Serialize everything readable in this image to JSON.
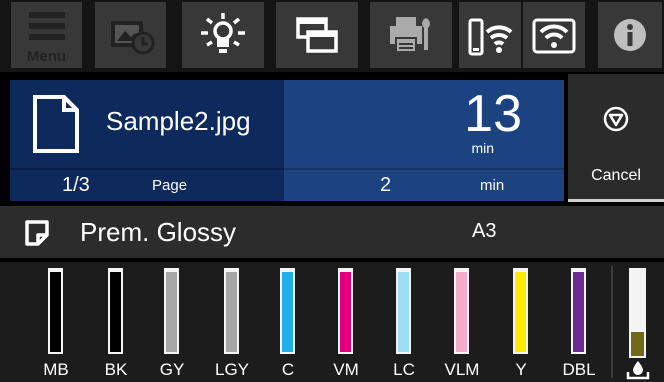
{
  "toolbar": {
    "menu_label": "Menu",
    "buttons": [
      {
        "icon": "menu-icon"
      },
      {
        "icon": "maintenance-schedule-icon"
      },
      {
        "icon": "printer-light-icon"
      },
      {
        "icon": "job-queue-icon"
      },
      {
        "icon": "printer-settings-icon"
      },
      {
        "icon": "wifi-direct-icon"
      },
      {
        "icon": "wifi-icon"
      },
      {
        "icon": "info-icon"
      }
    ]
  },
  "job": {
    "file_name": "Sample2.jpg",
    "remaining_time": "13",
    "remaining_time_unit": "min",
    "page_count": "1/3",
    "page_label": "Page",
    "page_time": "2",
    "page_time_unit": "min"
  },
  "cancel": {
    "label": "Cancel"
  },
  "media": {
    "type": "Prem. Glossy",
    "size": "A3"
  },
  "inks": [
    {
      "label": "MB",
      "color": "#000000",
      "level": 0.97
    },
    {
      "label": "BK",
      "color": "#000000",
      "level": 0.97
    },
    {
      "label": "GY",
      "color": "#a6a6a6",
      "level": 0.97
    },
    {
      "label": "LGY",
      "color": "#a6a6a6",
      "level": 0.97
    },
    {
      "label": "C",
      "color": "#1fb0e8",
      "level": 0.97
    },
    {
      "label": "VM",
      "color": "#e4007f",
      "level": 0.97
    },
    {
      "label": "LC",
      "color": "#9fdcf6",
      "level": 0.97
    },
    {
      "label": "VLM",
      "color": "#f4aac8",
      "level": 0.97
    },
    {
      "label": "Y",
      "color": "#ffec00",
      "level": 0.97
    },
    {
      "label": "DBL",
      "color": "#6c2a94",
      "level": 0.97
    }
  ],
  "maintenance_box": {
    "icon": "maintenance-box-icon",
    "level": 0.28
  }
}
